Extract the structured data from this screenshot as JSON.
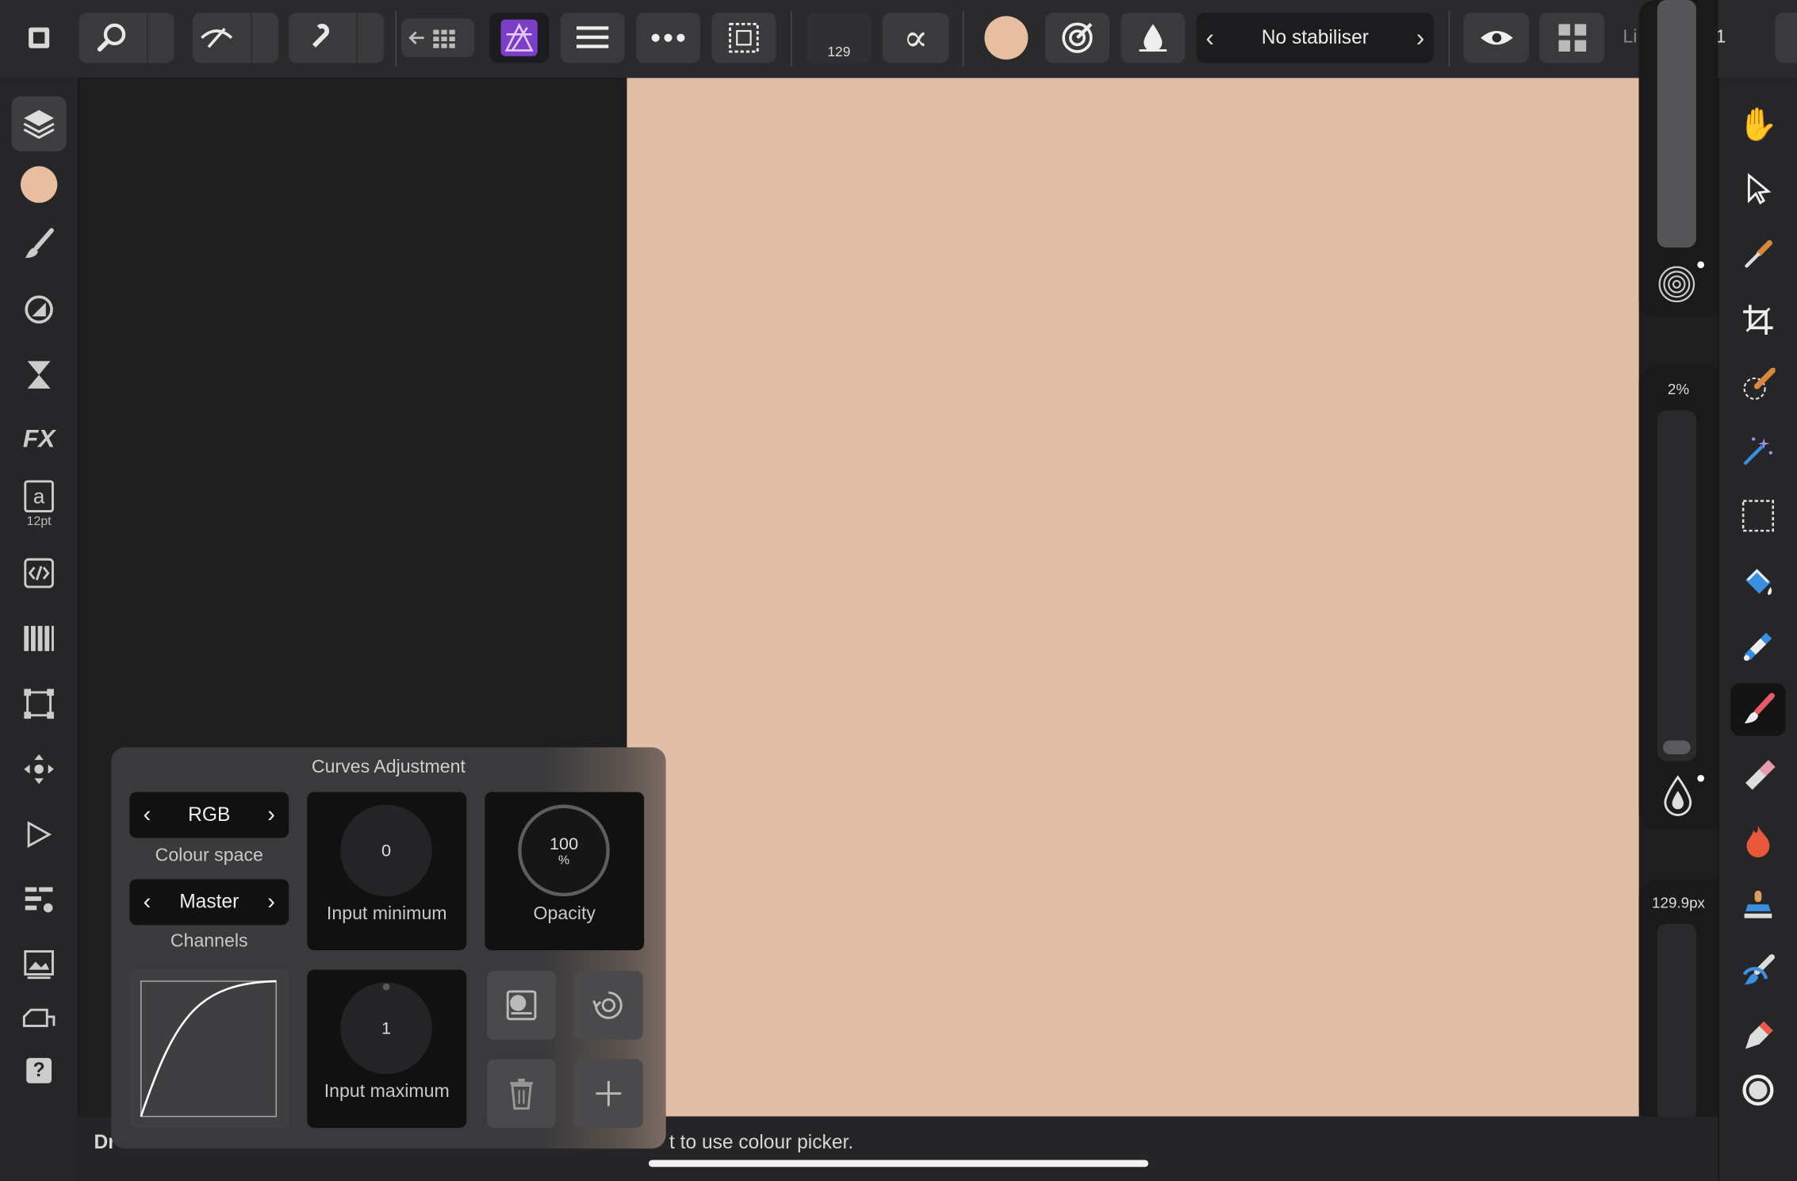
{
  "toolbar": {
    "brush_size_value": "129",
    "stabiliser_label": "No stabiliser",
    "layer_label_partial": "Li",
    "layer_value": "1",
    "current_colour": "#e8bea1",
    "affinity_icon_color": "#7a3fc5"
  },
  "left_sidebar": {
    "current_colour": "#e8bea1",
    "text_size_label": "12pt"
  },
  "right_sliders": {
    "opacity_value": "2%",
    "size_value": "129.9px"
  },
  "curves_panel": {
    "title": "Curves Adjustment",
    "colour_space_value": "RGB",
    "colour_space_label": "Colour space",
    "channel_value": "Master",
    "channels_label": "Channels",
    "input_minimum_value": "0",
    "input_minimum_label": "Input minimum",
    "input_maximum_value": "1",
    "input_maximum_label": "Input maximum",
    "opacity_value": "100",
    "opacity_unit": "%",
    "opacity_label": "Opacity"
  },
  "status": {
    "left_text": "Dr",
    "right_text": "t to use colour picker."
  },
  "colors": {
    "canvas": "#e1bea6",
    "accent_blue": "#3a8fe0",
    "active_brush": "#e85a6a"
  }
}
